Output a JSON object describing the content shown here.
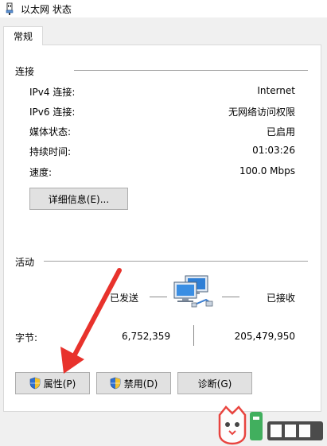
{
  "window": {
    "title": "以太网 状态"
  },
  "tab": {
    "label": "常规"
  },
  "connection": {
    "title": "连接",
    "rows": [
      {
        "label": "IPv4 连接:",
        "value": "Internet"
      },
      {
        "label": "IPv6 连接:",
        "value": "无网络访问权限"
      },
      {
        "label": "媒体状态:",
        "value": "已启用"
      },
      {
        "label": "持续时间:",
        "value": "01:03:26"
      },
      {
        "label": "速度:",
        "value": "100.0 Mbps"
      }
    ],
    "details_button": "详细信息(E)..."
  },
  "activity": {
    "title": "活动",
    "sent_label": "已发送",
    "received_label": "已接收",
    "bytes_label": "字节:",
    "bytes_sent": "6,752,359",
    "bytes_received": "205,479,950"
  },
  "buttons": {
    "properties": "属性(P)",
    "disable": "禁用(D)",
    "diagnose": "诊断(G)"
  },
  "colors": {
    "accent_arrow": "#e8322c",
    "panel_border": "#d9d9d9",
    "button_bg": "#e1e1e1"
  }
}
